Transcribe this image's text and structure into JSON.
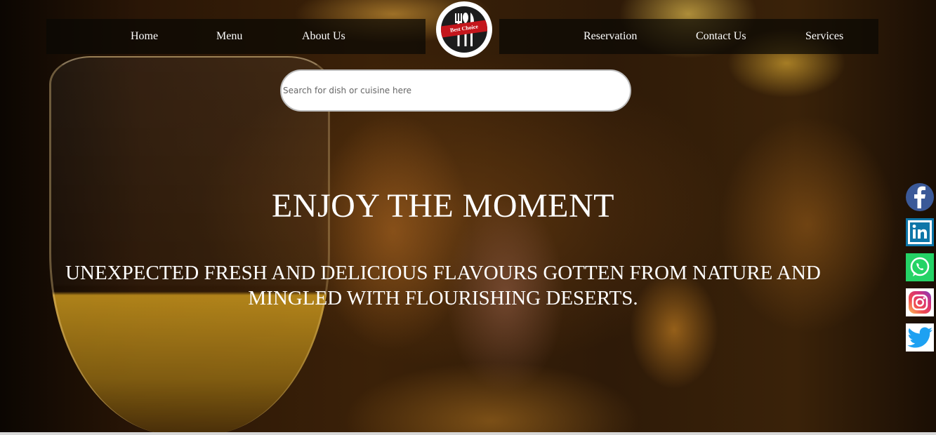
{
  "nav": {
    "left": [
      {
        "label": "Home"
      },
      {
        "label": "Menu"
      },
      {
        "label": "About Us"
      }
    ],
    "right": [
      {
        "label": "Reservation"
      },
      {
        "label": "Contact Us"
      },
      {
        "label": "Services"
      }
    ]
  },
  "logo": {
    "text": "Best Choice",
    "icon": "fork-spoon-knife-icon"
  },
  "search": {
    "placeholder": "Search for dish or cuisine here",
    "value": ""
  },
  "hero": {
    "title": "ENJOY THE MOMENT",
    "subtitle": "UNEXPECTED FRESH AND DELICIOUS FLAVOURS GOTTEN FROM NATURE AND MINGLED WITH FLOURISHING DESERTS."
  },
  "social": [
    {
      "name": "facebook-icon",
      "color": "#3b5998"
    },
    {
      "name": "linkedin-icon",
      "color": "#0e76a8"
    },
    {
      "name": "whatsapp-icon",
      "color": "#25d366"
    },
    {
      "name": "instagram-icon",
      "color": "#e1306c"
    },
    {
      "name": "twitter-icon",
      "color": "#1da1f2"
    }
  ],
  "colors": {
    "nav_bg": "#0a0804",
    "text": "#ffffff",
    "logo_red": "#c4161c"
  }
}
